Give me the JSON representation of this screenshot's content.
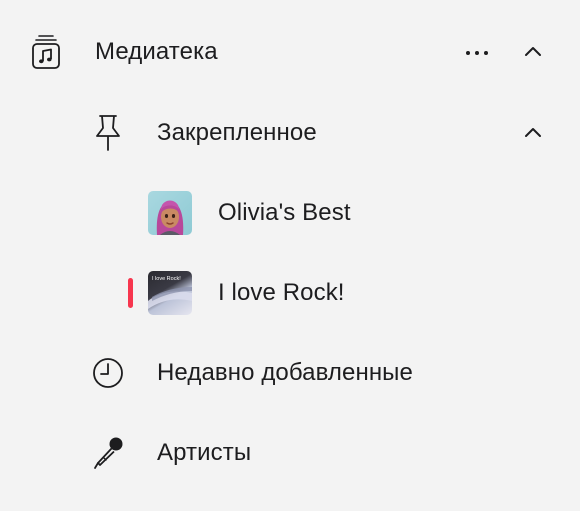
{
  "sidebar": {
    "library": {
      "label": "Медиатека",
      "icon": "music-library-icon"
    },
    "pinned": {
      "label": "Закрепленное",
      "icon": "pin-icon"
    },
    "playlists": [
      {
        "label": "Olivia's Best",
        "artwork": "memoji-artwork",
        "playing": false
      },
      {
        "label": "I love Rock!",
        "artwork_caption": "I love Rock!",
        "playing": true
      }
    ],
    "recently_added": {
      "label": "Недавно добавленные",
      "icon": "clock-icon"
    },
    "artists": {
      "label": "Артисты",
      "icon": "microphone-icon"
    }
  },
  "colors": {
    "background": "#f3f3f3",
    "text": "#1d1d1f",
    "now_playing_indicator": "#f7364e"
  }
}
